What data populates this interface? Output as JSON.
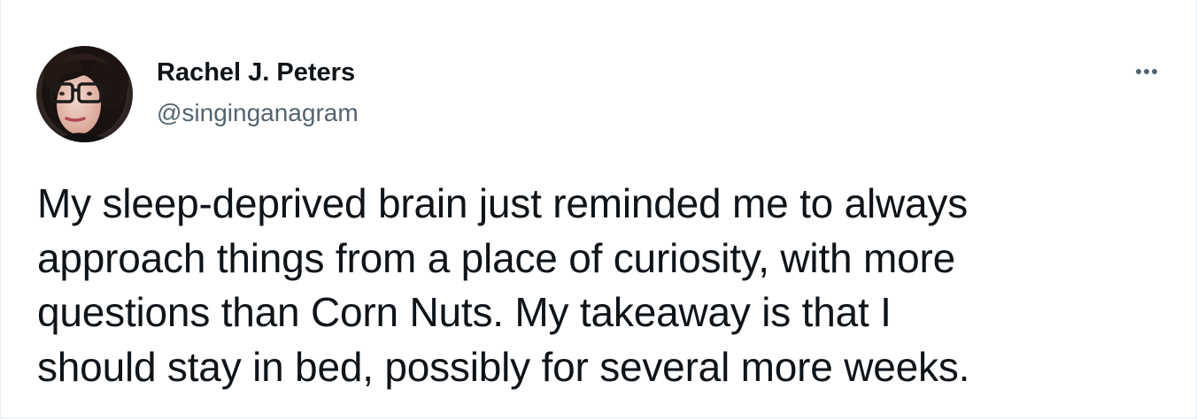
{
  "tweet": {
    "author": {
      "display_name": "Rachel J. Peters",
      "handle": "@singinganagram",
      "avatar_icon": "profile-photo"
    },
    "more_icon": "more-options-icon",
    "text": "My sleep-deprived brain just reminded me to always\napproach things from a place of curiosity, with more\nquestions than Corn Nuts. My takeaway is that I\nshould stay in bed, possibly for several more weeks."
  },
  "colors": {
    "text_primary": "#0f1419",
    "text_secondary": "#536471",
    "border": "#e6ecf0",
    "background": "#ffffff"
  }
}
